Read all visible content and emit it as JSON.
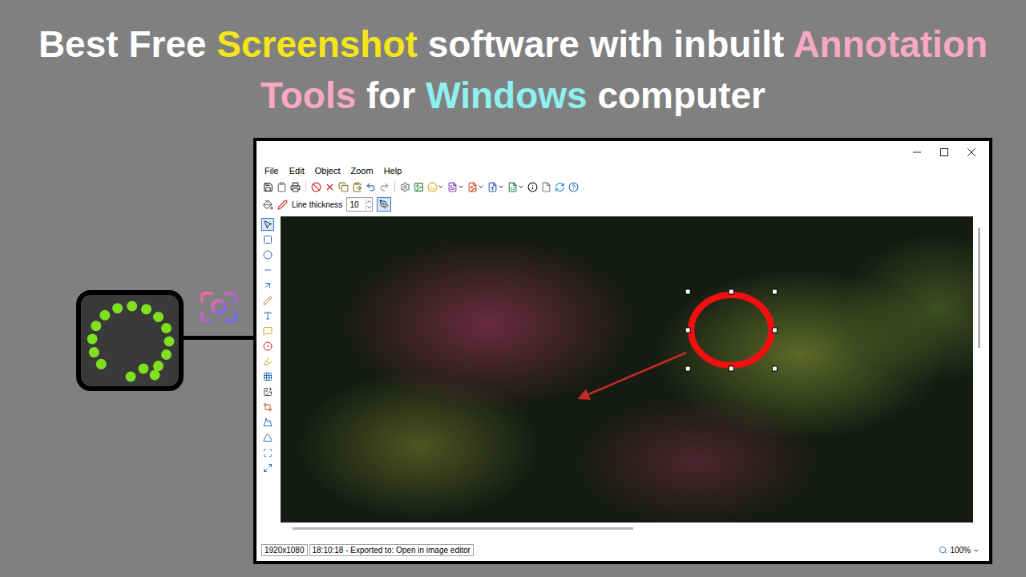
{
  "headline": {
    "lines": [
      [
        {
          "text": "Best Free ",
          "color": "#ffffff"
        },
        {
          "text": "Screenshot",
          "color": "#f5e61b"
        },
        {
          "text": " software with inbuilt ",
          "color": "#ffffff"
        },
        {
          "text": "Annotation",
          "color": "#f6a8c4"
        }
      ],
      [
        {
          "text": "Tools",
          "color": "#f6a8c4"
        },
        {
          "text": " for ",
          "color": "#ffffff"
        },
        {
          "text": "Windows",
          "color": "#8ff0f0"
        },
        {
          "text": " computer",
          "color": "#ffffff"
        }
      ]
    ]
  },
  "window": {
    "menu": [
      "File",
      "Edit",
      "Object",
      "Zoom",
      "Help"
    ],
    "options_bar": {
      "line_thickness_label": "Line thickness",
      "line_thickness_value": "10"
    },
    "tools": [
      {
        "selected": true
      },
      {
        "selected": false
      },
      {
        "selected": false
      },
      {
        "selected": false
      },
      {
        "selected": false
      },
      {
        "selected": false
      },
      {
        "selected": false
      },
      {
        "selected": false
      },
      {
        "selected": false
      },
      {
        "selected": false
      },
      {
        "selected": false
      },
      {
        "selected": false
      },
      {
        "selected": false
      },
      {
        "selected": false
      },
      {
        "selected": false
      },
      {
        "selected": false
      },
      {
        "selected": false
      }
    ],
    "annotations": [
      {
        "kind": "ellipse",
        "selected": true,
        "color": "#f01010"
      },
      {
        "kind": "arrow",
        "selected": false,
        "color": "#c42a2a"
      }
    ],
    "status_bar": {
      "resolution": "1920x1080",
      "message": "18:10:18 - Exported to: Open in image editor",
      "zoom": "100%"
    }
  }
}
